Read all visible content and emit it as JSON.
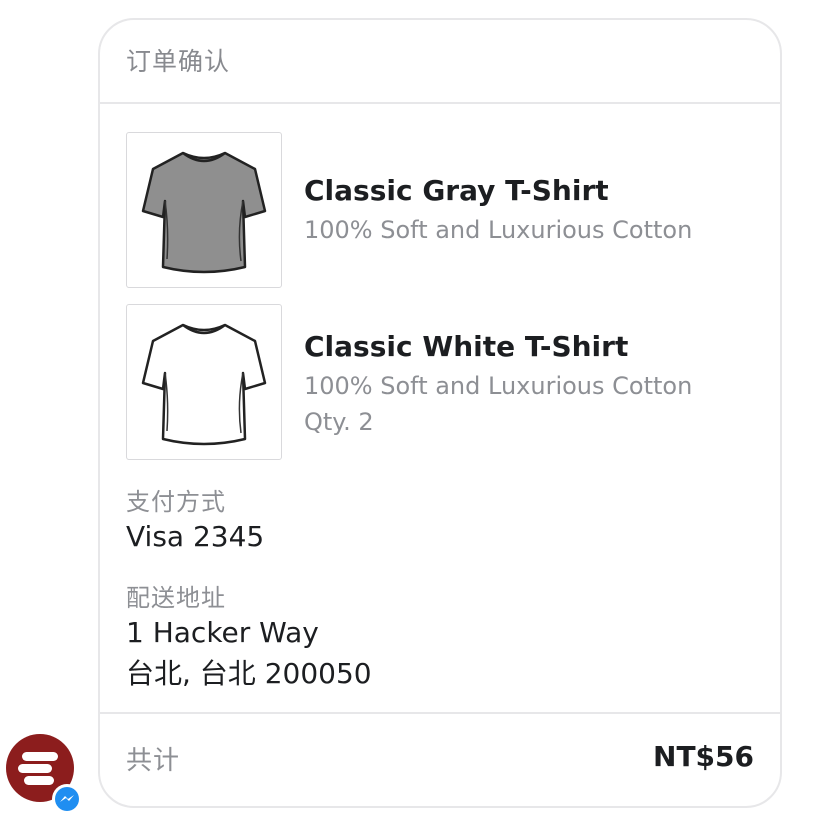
{
  "header": {
    "title": "订单确认"
  },
  "items": [
    {
      "title": "Classic Gray T-Shirt",
      "description": "100% Soft and Luxurious Cotton",
      "image_icon": "gray-tshirt-image",
      "color": "#8f8f8f"
    },
    {
      "title": "Classic White T-Shirt",
      "description": "100% Soft and Luxurious Cotton",
      "quantity": "Qty. 2",
      "image_icon": "white-tshirt-image",
      "color": "#ffffff"
    }
  ],
  "payment": {
    "label": "支付方式",
    "value": "Visa 2345"
  },
  "shipping": {
    "label": "配送地址",
    "line1": "1 Hacker Way",
    "line2": "台北, 台北 200050"
  },
  "footer": {
    "total_label": "共计",
    "total_value": "NT$56"
  },
  "sender": {
    "avatar_icon": "brand-avatar-icon",
    "avatar_color": "#8c1d1d",
    "badge_icon": "messenger-badge-icon",
    "badge_color": "#1f8ef1"
  }
}
